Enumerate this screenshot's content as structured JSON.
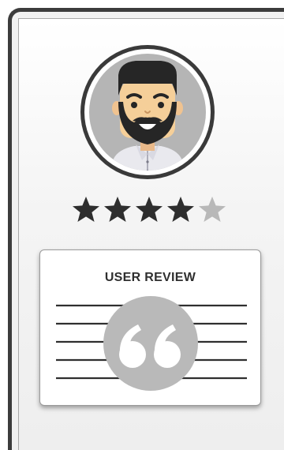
{
  "profile": {
    "rating": 4,
    "max_rating": 5,
    "avatar_icon": "bearded-man-avatar"
  },
  "review_card": {
    "title": "USER REVIEW",
    "icon": "quote-icon"
  },
  "colors": {
    "frame": "#3c3c3c",
    "star_filled": "#2e2e2e",
    "star_empty": "#b8b8b8",
    "avatar_bg": "#b5b5b5",
    "skin": "#f5cf99",
    "quote_circle": "#b9b9b9"
  }
}
